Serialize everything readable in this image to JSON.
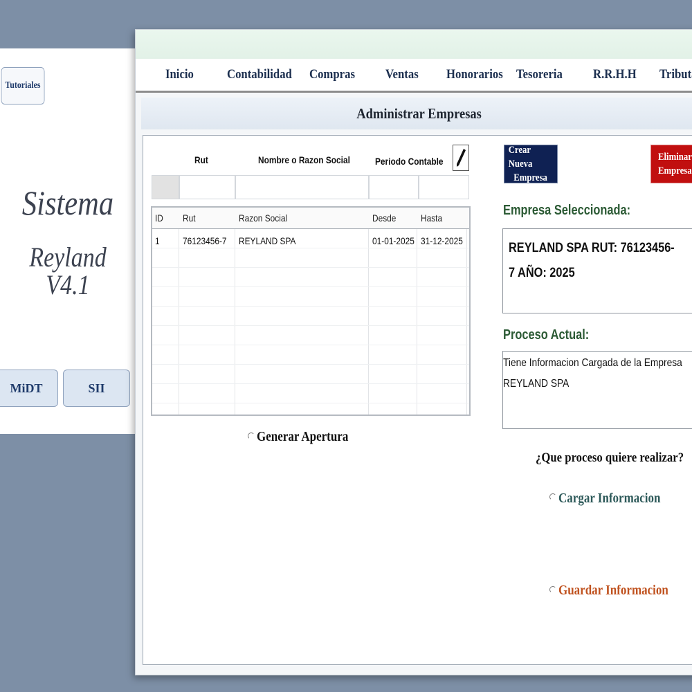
{
  "background": {
    "tutorials_label": "Tutoriales",
    "system_title": "Sistema",
    "system_version": "Reyland V4.1",
    "midt_label": "MiDT",
    "sii_label": "SII"
  },
  "menu": [
    "Inicio",
    "Contabilidad",
    "Compras",
    "Ventas",
    "Honorarios",
    "Tesoreria",
    "R.R.H.H",
    "Tributa"
  ],
  "header": {
    "title": "Administrar Empresas"
  },
  "filter": {
    "rut_label": "Rut",
    "name_label": "Nombre o Razon Social",
    "period_label": "Periodo Contable",
    "edit_icon": "pencil-icon"
  },
  "table": {
    "columns": [
      "ID",
      "Rut",
      "Razon Social",
      "Desde",
      "Hasta"
    ],
    "rows": [
      {
        "id": "1",
        "rut": "76123456-7",
        "razon_social": "REYLAND SPA",
        "desde": "01-01-2025",
        "hasta": "31-12-2025"
      }
    ]
  },
  "actions": {
    "generate_opening": "Generar Apertura",
    "create_line1": "Crear Nueva",
    "create_line2": "Empresa",
    "delete_line1": "Eliminar",
    "delete_line2": "Empresa"
  },
  "selected": {
    "label": "Empresa Seleccionada:",
    "value": "REYLAND SPA  RUT: 76123456-7  AÑO: 2025"
  },
  "process": {
    "label": "Proceso Actual:",
    "value": "Tiene Informacion Cargada de la Empresa REYLAND SPA",
    "question": "¿Que proceso quiere realizar?",
    "load": "Cargar Informacion",
    "save": "Guardar Informacion"
  },
  "colors": {
    "create_button": "#0f2153",
    "delete_button": "#c10f0f",
    "section_label": "#2b5a34",
    "load_option": "#2e5a5a",
    "save_option": "#c0521f"
  }
}
